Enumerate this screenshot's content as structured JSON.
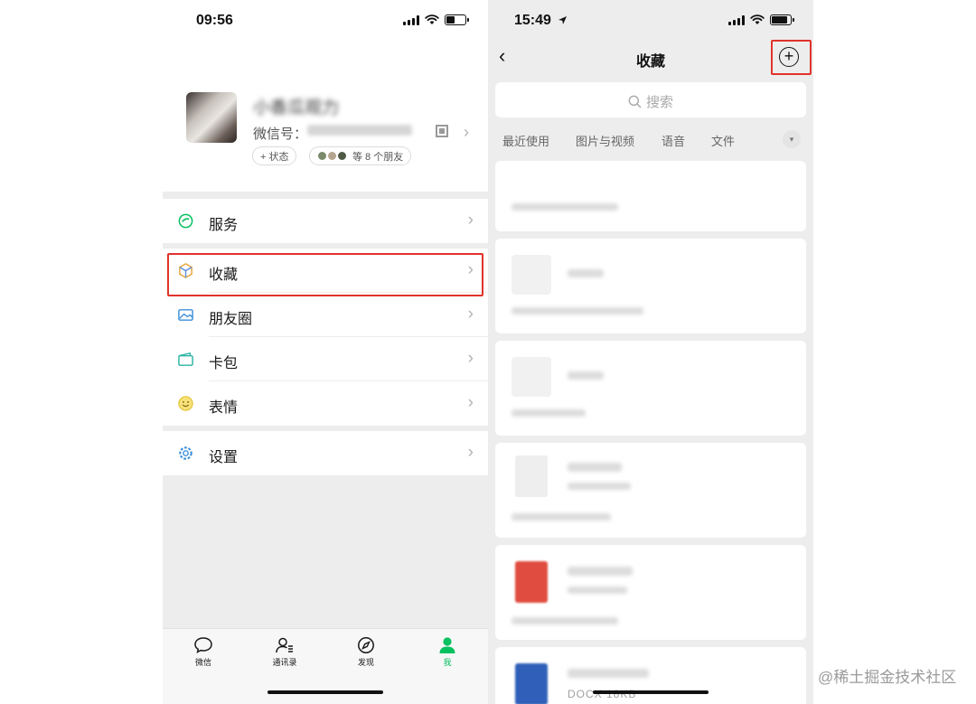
{
  "left_phone": {
    "status_time": "09:56",
    "profile": {
      "nickname": "小香瓜观力",
      "wechat_id_label": "微信号：",
      "status_button": "+ 状态",
      "friends_text": "等 8 个朋友"
    },
    "menu": {
      "services": "服务",
      "favorites": "收藏",
      "moments": "朋友圈",
      "cards": "卡包",
      "stickers": "表情",
      "settings": "设置"
    },
    "tabs": [
      "微信",
      "通讯录",
      "发现",
      "我"
    ],
    "active_tab": "我"
  },
  "right_phone": {
    "status_time": "15:49",
    "title": "收藏",
    "search_placeholder": "搜索",
    "filters": [
      "最近使用",
      "图片与视频",
      "语音",
      "文件"
    ],
    "last_item_type": "DOCX 18KB"
  },
  "watermark": "@稀土掘金技术社区",
  "colors": {
    "wechat_green": "#07c160",
    "highlight_red": "#e0332b",
    "page_bg": "#ededed"
  }
}
